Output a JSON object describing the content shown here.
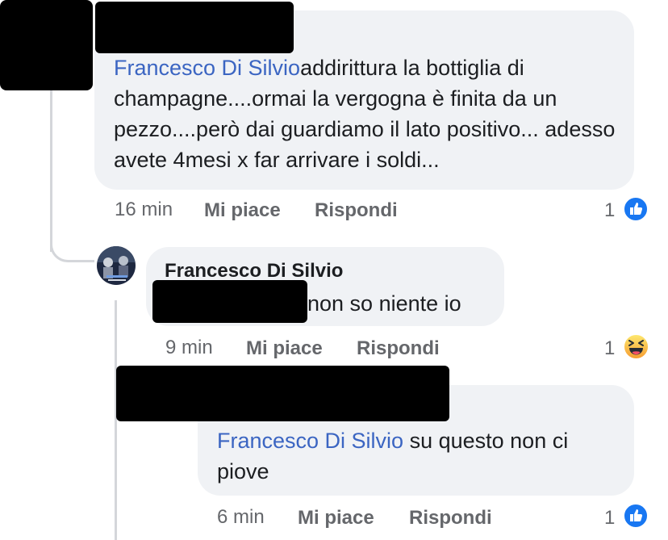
{
  "comments": [
    {
      "mention": "Francesco Di Silvio",
      "text": "addirittura la bottiglia di champagne....ormai la vergogna è finita da un pezzo....però dai guardiamo il lato positivo... adesso avete 4mesi x far arrivare i soldi...",
      "time": "16 min",
      "like_label": "Mi piace",
      "reply_label": "Rispondi",
      "reaction_count": "1",
      "reaction_icon": "like-icon"
    },
    {
      "author": "Francesco Di Silvio",
      "text": "non so niente io",
      "time": "9 min",
      "like_label": "Mi piace",
      "reply_label": "Rispondi",
      "reaction_count": "1",
      "reaction_icon": "haha-icon"
    },
    {
      "mention": "Francesco Di Silvio",
      "text": " su questo non ci piove",
      "time": "6 min",
      "like_label": "Mi piace",
      "reply_label": "Rispondi",
      "reaction_count": "1",
      "reaction_icon": "like-icon"
    }
  ],
  "colors": {
    "bubble": "#f0f2f5",
    "mention": "#3b65c2",
    "meta": "#65676b",
    "like_blue": "#1877f2",
    "haha_yellow": "#f7b125"
  }
}
